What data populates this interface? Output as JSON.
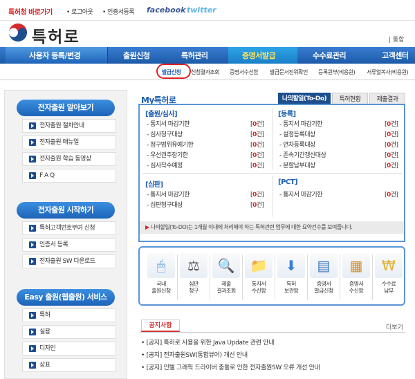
{
  "topbar": {
    "quick_link": "특허청 바로가기",
    "logout": "• 로그아웃",
    "cert_register": "• 인증서등록",
    "facebook": "facebook",
    "twitter": "twitter"
  },
  "header": {
    "logo_text": "특허로",
    "total_search": "| 통합"
  },
  "gnb": {
    "items": [
      "사용자 등록/변경",
      "출원신청",
      "특허관리",
      "증명서발급",
      "수수료관리",
      "고객센터"
    ],
    "active": "증명서발급"
  },
  "subnav": {
    "items": [
      "발급신청",
      "신청결과조회",
      "증명서수신함",
      "발급문서진위확인",
      "등록원부(비용원)",
      "서류열복사(비용원)"
    ],
    "circled": "발급신청"
  },
  "left": {
    "section1": {
      "title": "전자출원 알아보기",
      "items": [
        "전자출원 절차안내",
        "전자출원 매뉴얼",
        "전자출원 학습 동영상",
        "F A Q"
      ]
    },
    "section2": {
      "title": "전자출원 시작하기",
      "items": [
        "특허고객번호부여 신청",
        "인증서 등록",
        "전자출원 SW 다운로드"
      ]
    },
    "section3": {
      "title": "Easy 출원(웹출원) 서비스",
      "items": [
        "특허",
        "실용",
        "디자인",
        "상표"
      ]
    }
  },
  "my": {
    "title": "My특허로",
    "tabs": [
      "나의할일(To-Do)",
      "특허현황",
      "제출결과"
    ],
    "sections": {
      "application": {
        "title": "[출원/심사]",
        "rows": [
          {
            "label": "- 통지서 마감기한",
            "count": "0"
          },
          {
            "label": "- 심사청구대상",
            "count": "0"
          },
          {
            "label": "- 청구범위유예기한",
            "count": "0"
          },
          {
            "label": "- 우선권주장기한",
            "count": "0"
          },
          {
            "label": "- 심사착수예정",
            "count": "0"
          }
        ]
      },
      "registration": {
        "title": "[등록]",
        "rows": [
          {
            "label": "- 통지서 마감기한",
            "count": "0"
          },
          {
            "label": "- 설정등록대상",
            "count": "0"
          },
          {
            "label": "- 연차등록대상",
            "count": "0"
          },
          {
            "label": "- 존속기간갱신대상",
            "count": "0"
          },
          {
            "label": "- 분할납부대상",
            "count": "0"
          }
        ]
      },
      "trial": {
        "title": "[심판]",
        "rows": [
          {
            "label": "- 통지서 마감기한",
            "count": "0"
          },
          {
            "label": "- 심판청구대상",
            "count": "0"
          }
        ]
      },
      "pct": {
        "title": "[PCT]",
        "rows": [
          {
            "label": "- 통지서 마감기한",
            "count": "0"
          }
        ]
      }
    },
    "count_open": "[",
    "count_close": "건]",
    "notice": "나의할일(To-DO)는 1개월 이내에 처리해야 하는 특허관련 업무에 대한 요약건수를 보여줍니다."
  },
  "icons": [
    {
      "label1": "국내",
      "label2": "출원신청",
      "icon": "mouse-icon"
    },
    {
      "label1": "심판",
      "label2": "청구",
      "icon": "gavel-icon"
    },
    {
      "label1": "제출",
      "label2": "결과조회",
      "icon": "magnifier-doc-icon"
    },
    {
      "label1": "통지서",
      "label2": "수신함",
      "icon": "folder-icon"
    },
    {
      "label1": "특허",
      "label2": "보관함",
      "icon": "download-box-icon"
    },
    {
      "label1": "증명서",
      "label2": "발급신청",
      "icon": "certificate-icon"
    },
    {
      "label1": "증명서",
      "label2": "수신함",
      "icon": "calendar-icon"
    },
    {
      "label1": "수수료",
      "label2": "납부",
      "icon": "fee-icon"
    }
  ],
  "notice_board": {
    "tab": "공지사항",
    "more": "더보기",
    "items": [
      "• [공지] 특허로 사용을 위한 Java Update 관련 안내",
      "• [공지] 전자출원SW(통합뷰어) 개선 안내",
      "• [공지] 인텔 그래픽 드라이버 충돌로 인한 전자출원SW 오류 개선 안내"
    ]
  },
  "colors": {
    "brand_blue": "#1f5fb0",
    "accent_red": "#e02020"
  }
}
